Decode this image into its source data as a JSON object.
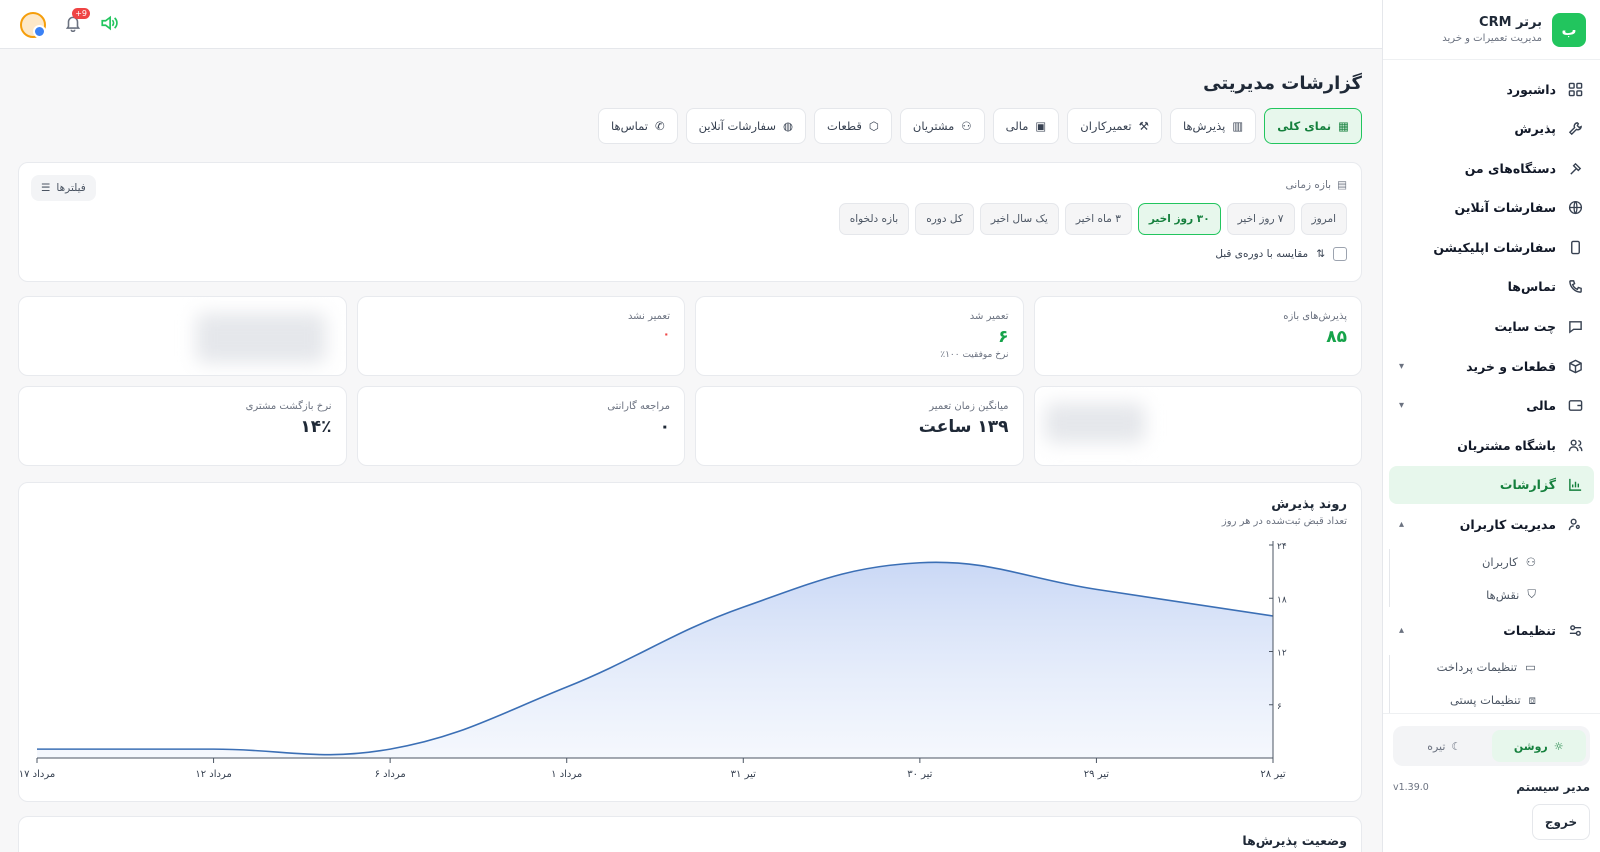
{
  "brand": {
    "logo": "ب",
    "title": "برتر CRM",
    "subtitle": "مدیریت تعمیرات و خرید"
  },
  "sidebar": {
    "items": [
      {
        "label": "داشبورد",
        "icon": "dashboard-icon"
      },
      {
        "label": "پذیرش",
        "icon": "wrench-icon"
      },
      {
        "label": "دستگاه‌های من",
        "icon": "hammer-icon"
      },
      {
        "label": "سفارشات آنلاین",
        "icon": "globe-icon"
      },
      {
        "label": "سفارشات اپلیکیشن",
        "icon": "phone-device-icon"
      },
      {
        "label": "تماس‌ها",
        "icon": "phone-icon"
      },
      {
        "label": "چت سایت",
        "icon": "chat-icon"
      },
      {
        "label": "قطعات و خرید",
        "icon": "box-icon"
      },
      {
        "label": "مالی",
        "icon": "wallet-icon"
      },
      {
        "label": "باشگاه مشتریان",
        "icon": "users-icon"
      },
      {
        "label": "گزارشات",
        "icon": "chart-icon"
      },
      {
        "label": "مدیریت کاربران",
        "icon": "user-gear-icon"
      }
    ],
    "user_sub": [
      {
        "label": "کاربران"
      },
      {
        "label": "نقش‌ها"
      }
    ],
    "settings": {
      "label": "تنظیمات"
    },
    "settings_sub": [
      {
        "label": "تنظیمات پرداخت"
      },
      {
        "label": "تنظیمات پستی"
      }
    ],
    "theme": {
      "light": "روشن",
      "dark": "تیره"
    },
    "user_name": "مدیر سیستم",
    "version": "v1.39.0",
    "logout": "خروج"
  },
  "topbar": {
    "notification_count": "+9"
  },
  "page": {
    "title": "گزارشات مدیریتی",
    "tabs": [
      "نمای کلی",
      "پذیرش‌ها",
      "تعمیرکاران",
      "مالی",
      "مشتریان",
      "قطعات",
      "سفارشات آنلاین",
      "تماس‌ها"
    ]
  },
  "filters": {
    "range_label": "بازه زمانی",
    "ranges": [
      "امروز",
      "۷ روز اخیر",
      "۳۰ روز اخیر",
      "۳ ماه اخیر",
      "یک سال اخیر",
      "کل دوره",
      "بازه دلخواه"
    ],
    "selected_range": "۳۰ روز اخیر",
    "compare_label": "مقایسه با دوره‌ی قبل",
    "filters_button": "فیلترها"
  },
  "stats": {
    "row1": [
      {
        "label": "پذیرش‌های بازه",
        "value": "۸۵",
        "sub": ""
      },
      {
        "label": "تعمیر شد",
        "value": "۶",
        "sub": "نرخ موفقیت ۱۰۰٪"
      },
      {
        "label": "تعمیر نشد",
        "value": "۰",
        "sub": ""
      }
    ],
    "row2": [
      {
        "label": "میانگین زمان تعمیر",
        "value": "۱۳۹ ساعت"
      },
      {
        "label": "مراجعه گارانتی",
        "value": "۰"
      },
      {
        "label": "نرخ بازگشت مشتری",
        "value": "۱۴٪"
      }
    ]
  },
  "chart_data": {
    "type": "area",
    "title": "روند پذیرش",
    "subtitle": "تعداد قبض ثبت‌شده در هر روز",
    "x": [
      "۲۸ تیر",
      "۲۹ تیر",
      "۳۰ تیر",
      "۳۱ تیر",
      "۱ مرداد",
      "۶ مرداد",
      "۱۲ مرداد",
      "۱۷ مرداد"
    ],
    "values": [
      16,
      19,
      22,
      17,
      8,
      1,
      1,
      1
    ],
    "yticks": [
      "۶",
      "۱۲",
      "۱۸",
      "۲۴"
    ],
    "ylim": [
      0,
      24
    ],
    "color": "#3b6fb5"
  },
  "status_section": {
    "title": "وضعیت پذیرش‌ها"
  }
}
